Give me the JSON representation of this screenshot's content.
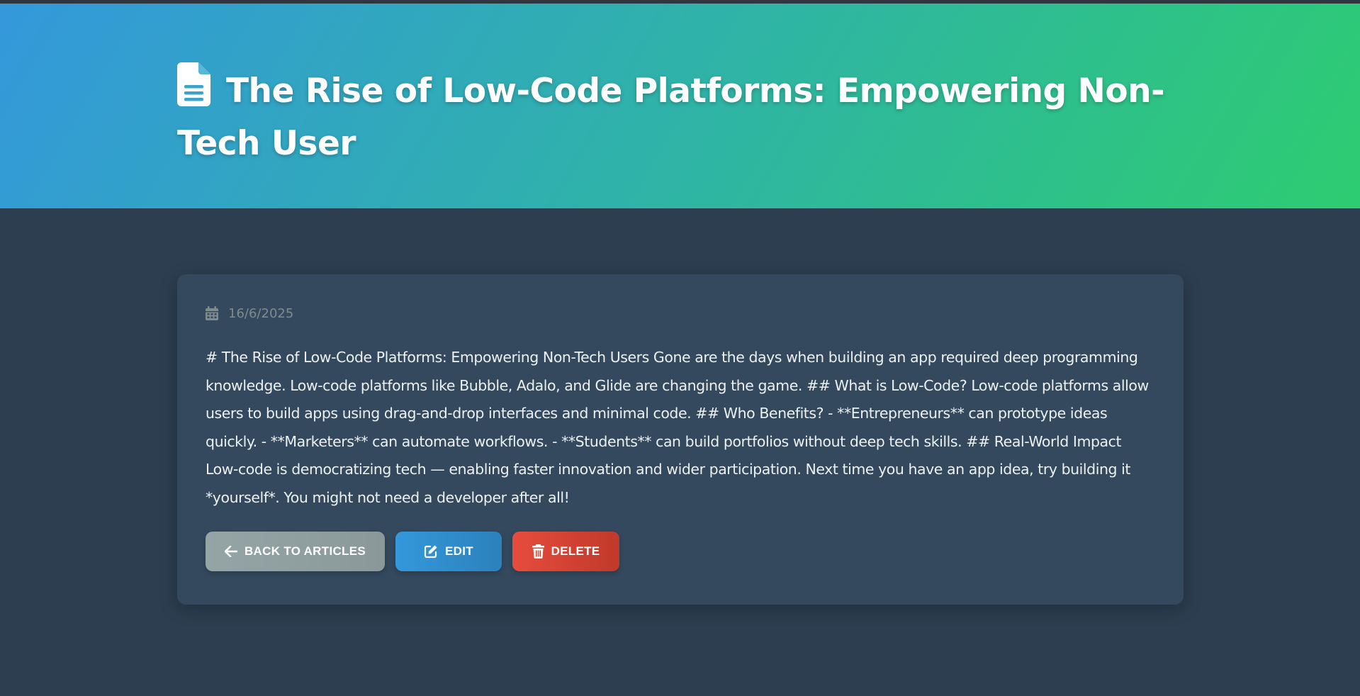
{
  "header": {
    "title": "The Rise of Low-Code Platforms: Empowering Non-Tech User",
    "icon": "document-icon"
  },
  "article": {
    "date": "16/6/2025",
    "date_icon": "calendar-icon",
    "body": "# The Rise of Low-Code Platforms: Empowering Non-Tech Users Gone are the days when building an app required deep programming knowledge. Low-code platforms like Bubble, Adalo, and Glide are changing the game. ## What is Low-Code? Low-code platforms allow users to build apps using drag-and-drop interfaces and minimal code. ## Who Benefits? - **Entrepreneurs** can prototype ideas quickly. - **Marketers** can automate workflows. - **Students** can build portfolios without deep tech skills. ## Real-World Impact Low-code is democratizing tech — enabling faster innovation and wider participation. Next time you have an app idea, try building it *yourself*. You might not need a developer after all!"
  },
  "actions": {
    "back_label": "BACK TO ARTICLES",
    "edit_label": "EDIT",
    "delete_label": "DELETE"
  },
  "colors": {
    "hero_gradient_start": "#3498db",
    "hero_gradient_end": "#2ecc71",
    "page_bg": "#2c3e50",
    "card_bg": "#34495e",
    "back_button": "#95a5a6",
    "edit_button": "#3498db",
    "delete_button": "#e74c3c"
  }
}
